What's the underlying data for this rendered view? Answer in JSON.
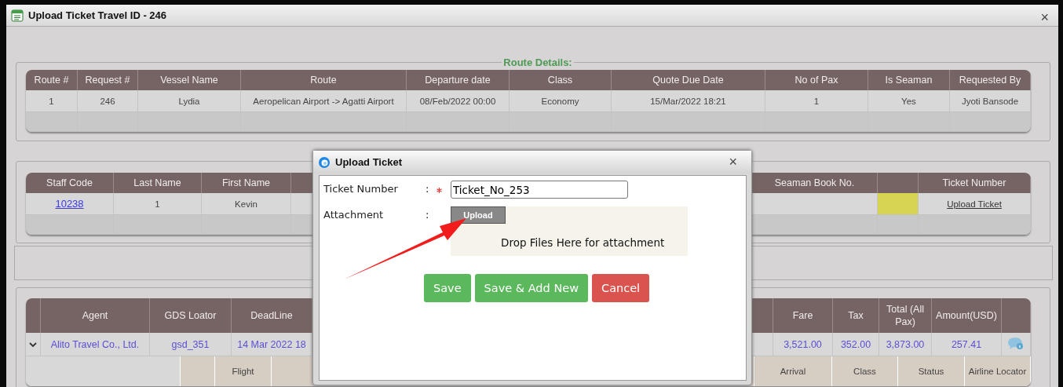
{
  "window": {
    "title": "Upload Ticket Travel ID - 246",
    "close": "×"
  },
  "route_details": {
    "legend": "Route Details:",
    "columns": [
      "Route #",
      "Request #",
      "Vessel Name",
      "Route",
      "Departure date",
      "Class",
      "Quote Due Date",
      "No of Pax",
      "Is Seaman",
      "Requested By"
    ],
    "rows": [
      [
        "1",
        "246",
        "Lydia",
        "Aeropelican Airport -> Agatti Airport",
        "08/Feb/2022 00:00",
        "Economy",
        "15/Mar/2022 18:21",
        "1",
        "Yes",
        "Jyoti Bansode"
      ]
    ]
  },
  "staff": {
    "columns": [
      "Staff Code",
      "Last Name",
      "First Name",
      "Seaman Book No.",
      "Ticket Number"
    ],
    "rows": [
      {
        "staff_code": "10238",
        "last_name": "1",
        "first_name": "Kevin",
        "ticket_link": "Upload Ticket"
      }
    ]
  },
  "quotes": {
    "columns": [
      "Agent",
      "GDS Loator",
      "DeadLine",
      "Fare",
      "Tax",
      "Total (All Pax)",
      "Amount(USD)"
    ],
    "rows": [
      {
        "expanded": true,
        "agent": "Alito Travel Co., Ltd.",
        "gds": "gsd_351",
        "deadline": "14 Mar 2022 18",
        "fare": "3,521.00",
        "tax": "352.00",
        "total": "3,873.00",
        "amount": "257.41",
        "detail_columns": [
          "Flight",
          "Arrival",
          "Class",
          "Status",
          "Airline Locator"
        ]
      }
    ]
  },
  "dialog": {
    "title": "Upload Ticket",
    "close": "×",
    "fields": [
      {
        "kind": "text",
        "label": "Ticket Number",
        "colon": ":",
        "required": true,
        "value": "Ticket_No_253"
      },
      {
        "kind": "file",
        "label": "Attachment",
        "colon": ":",
        "required": false,
        "button": "Upload",
        "drop_hint": "Drop Files Here for attachment"
      }
    ],
    "buttons": [
      {
        "label": "Save",
        "kind": "primary"
      },
      {
        "label": "Save & Add New",
        "kind": "primary"
      },
      {
        "label": "Cancel",
        "kind": "danger"
      }
    ]
  }
}
